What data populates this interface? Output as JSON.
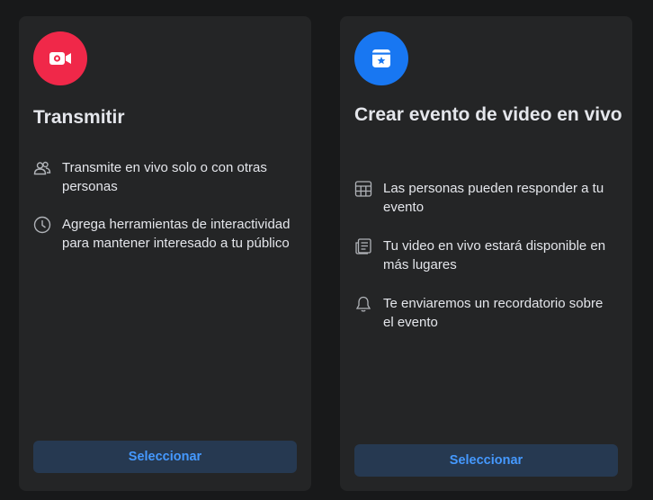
{
  "cards": [
    {
      "title": "Transmitir",
      "badge_color": "#f02849",
      "badge_icon": "video-camera-icon",
      "features": [
        {
          "icon": "people-icon",
          "text": "Transmite en vivo solo o con otras personas"
        },
        {
          "icon": "clock-icon",
          "text": "Agrega herramientas de interactividad para mantener interesado a tu público"
        }
      ],
      "button_label": "Seleccionar"
    },
    {
      "title": "Crear evento de video en vivo",
      "badge_color": "#1877f2",
      "badge_icon": "calendar-star-icon",
      "features": [
        {
          "icon": "calendar-grid-icon",
          "text": "Las personas pueden responder a tu evento"
        },
        {
          "icon": "news-feed-icon",
          "text": "Tu video en vivo estará disponible en más lugares"
        },
        {
          "icon": "bell-icon",
          "text": "Te enviaremos un recordatorio sobre el evento"
        }
      ],
      "button_label": "Seleccionar"
    }
  ],
  "colors": {
    "background": "#18191a",
    "card": "#242526",
    "text": "#e4e6eb",
    "icon": "#b0b3b8",
    "button_bg": "#263951",
    "button_text": "#4599ff"
  }
}
